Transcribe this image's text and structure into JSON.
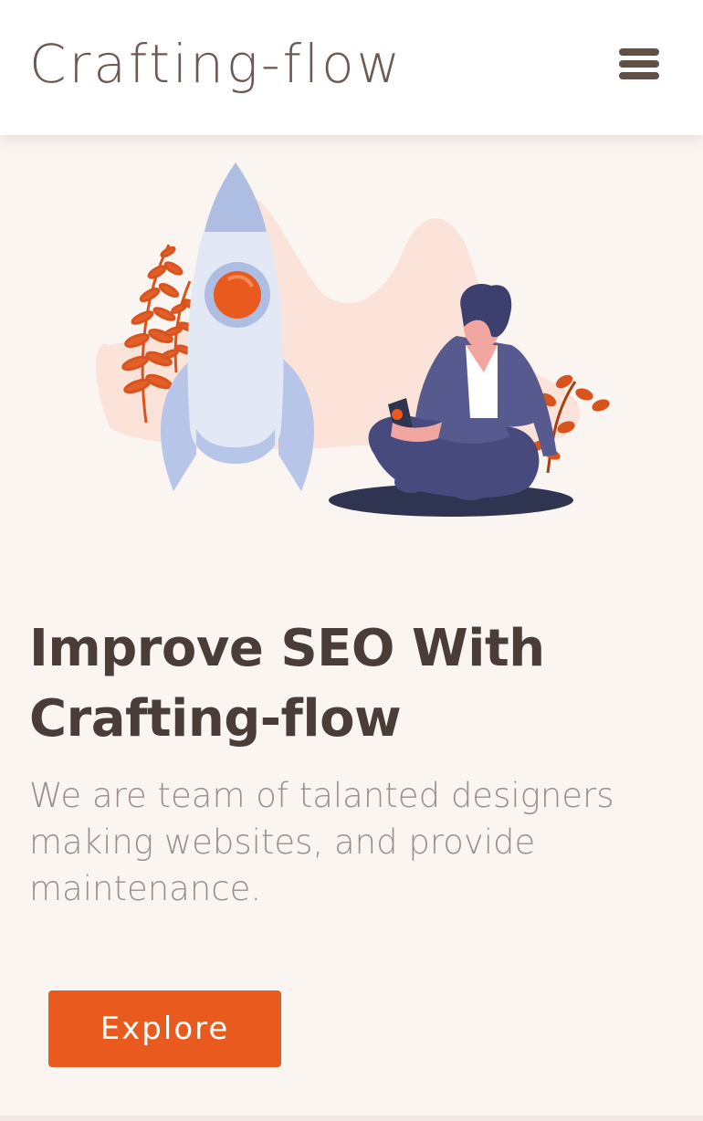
{
  "header": {
    "brand": "Crafting-flow",
    "menu_icon": "hamburger-menu-icon"
  },
  "hero": {
    "illustration": "rocket-and-person-illustration",
    "headline": "Improve SEO With Crafting-flow",
    "subtext": "We are team of talanted designers making websites, and provide maintenance.",
    "cta_label": "Explore"
  },
  "colors": {
    "accent": "#e95a1f",
    "background": "#fbf5f2",
    "heading": "#4a3d38",
    "body_text": "#9a8e89",
    "brand_text": "#6b5a52"
  }
}
